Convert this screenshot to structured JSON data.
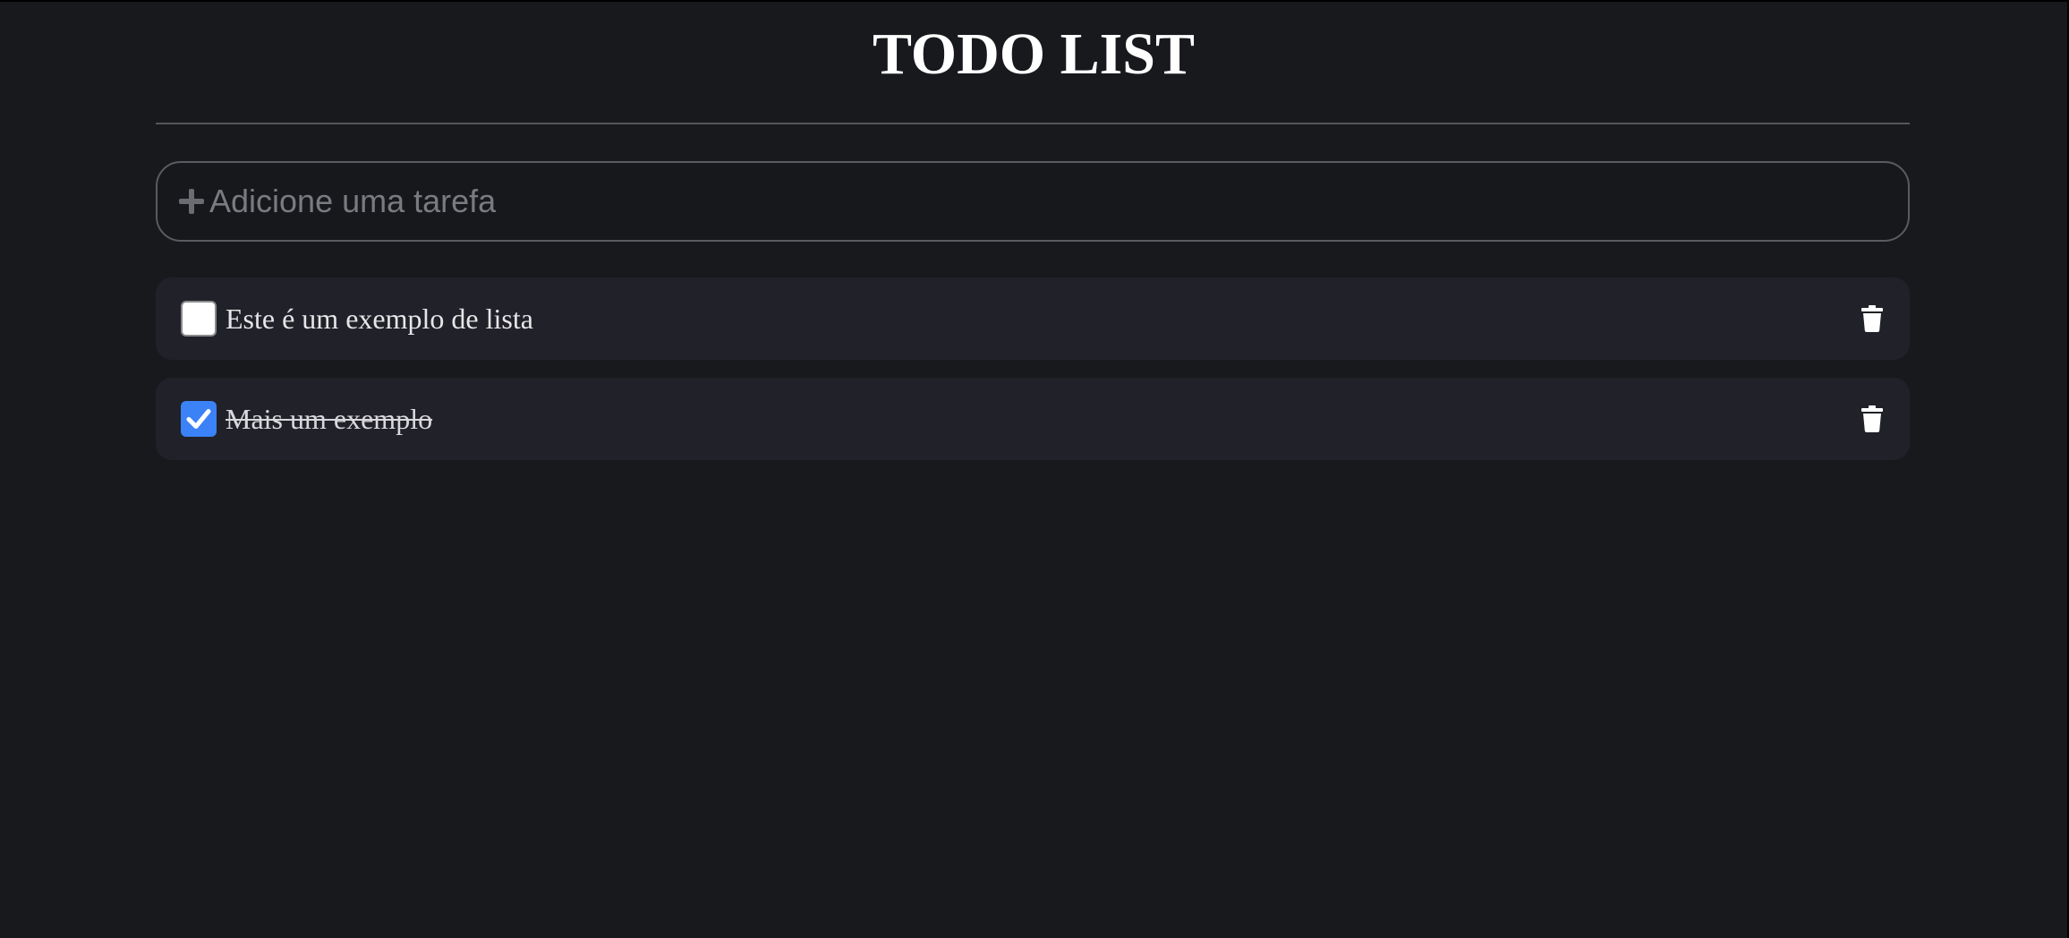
{
  "header": {
    "title": "TODO LIST"
  },
  "add_task": {
    "placeholder": "Adicione uma tarefa",
    "value": ""
  },
  "tasks": [
    {
      "text": "Este é um exemplo de lista",
      "completed": false
    },
    {
      "text": "Mais um exemplo",
      "completed": true
    }
  ],
  "icons": {
    "add": "plus-icon",
    "delete": "trash-icon",
    "check": "checkmark-icon"
  },
  "colors": {
    "background": "#18191d",
    "task_background": "#212129",
    "checkbox_checked": "#3b82f6",
    "text": "#ffffff"
  }
}
